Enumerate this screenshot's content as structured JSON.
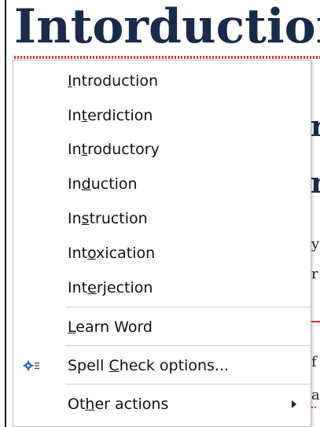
{
  "document": {
    "heading": "Intorduction",
    "background_fragments": [
      "r",
      "r",
      "y",
      "r",
      "f",
      "a"
    ]
  },
  "context_menu": {
    "suggestions": [
      {
        "label": "Introduction",
        "accesskey_index": 0
      },
      {
        "label": "Interdiction",
        "accesskey_index": 2
      },
      {
        "label": "Introductory",
        "accesskey_index": 2
      },
      {
        "label": "Induction",
        "accesskey_index": 2
      },
      {
        "label": "Instruction",
        "accesskey_index": 2
      },
      {
        "label": "Intoxication",
        "accesskey_index": 3
      },
      {
        "label": "Interjection",
        "accesskey_index": 3
      }
    ],
    "learn_word": {
      "label": "Learn Word",
      "accesskey_index": 0
    },
    "spell_check_options": {
      "label": "Spell Check options...",
      "accesskey_index": 6,
      "icon": "gear-list-icon"
    },
    "other_actions": {
      "label": "Other actions",
      "accesskey_index": 2,
      "icon": "submenu-arrow-icon"
    }
  },
  "colors": {
    "heading": "#1a2a4a",
    "squiggle": "#e03030",
    "menu_border": "#bdbdbd",
    "gear_icon": "#2e6fb5"
  }
}
